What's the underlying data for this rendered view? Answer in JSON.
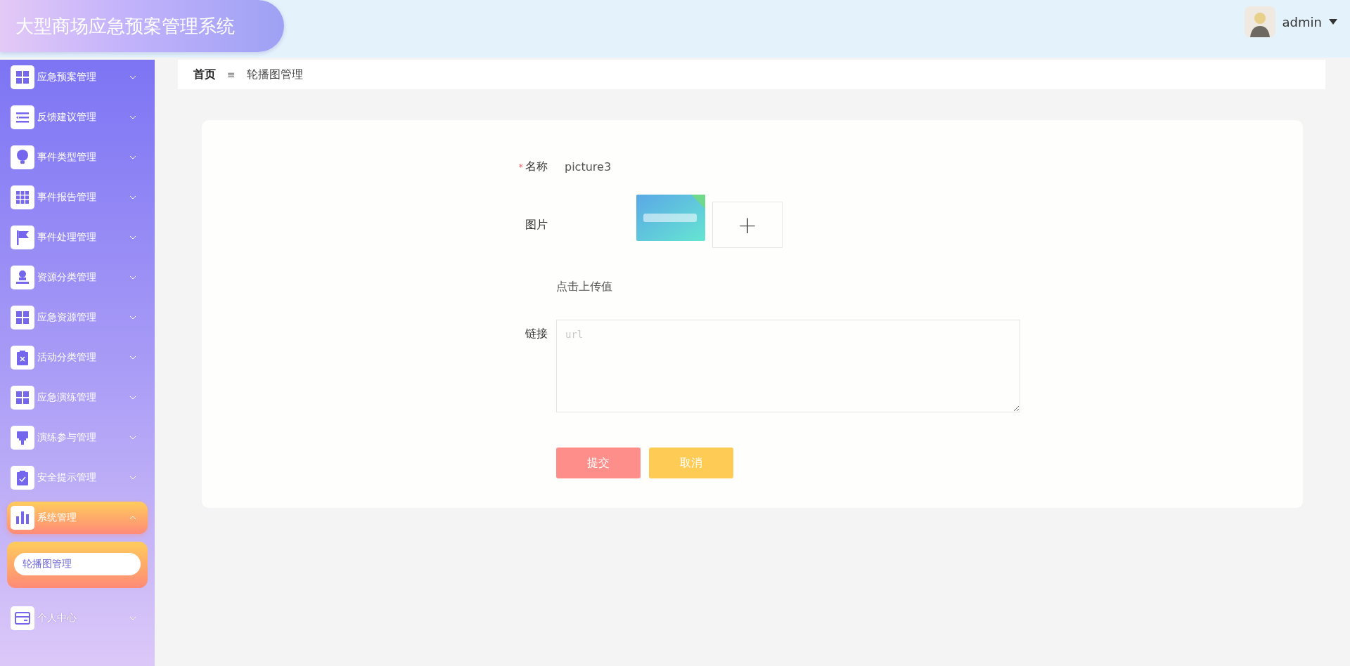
{
  "header": {
    "title": "大型商场应急预案管理系统",
    "user": {
      "name": "admin"
    }
  },
  "sidebar": {
    "items": [
      {
        "label": "应急预案管理",
        "expanded": false
      },
      {
        "label": "反馈建议管理",
        "expanded": false
      },
      {
        "label": "事件类型管理",
        "expanded": false
      },
      {
        "label": "事件报告管理",
        "expanded": false
      },
      {
        "label": "事件处理管理",
        "expanded": false
      },
      {
        "label": "资源分类管理",
        "expanded": false
      },
      {
        "label": "应急资源管理",
        "expanded": false
      },
      {
        "label": "活动分类管理",
        "expanded": false
      },
      {
        "label": "应急演练管理",
        "expanded": false
      },
      {
        "label": "演练参与管理",
        "expanded": false
      },
      {
        "label": "安全提示管理",
        "expanded": false
      },
      {
        "label": "系统管理",
        "expanded": true,
        "children": [
          {
            "label": "轮播图管理",
            "selected": true
          }
        ]
      },
      {
        "label": "个人中心",
        "expanded": false
      }
    ]
  },
  "breadcrumb": {
    "items": [
      "首页",
      "轮播图管理"
    ],
    "separator": "≡"
  },
  "form": {
    "name": {
      "label": "名称",
      "required": true,
      "required_mark": "*",
      "value": "picture3"
    },
    "picture": {
      "label": "图片",
      "hint": "点击上传值",
      "upload_symbol": "+"
    },
    "link": {
      "label": "链接",
      "placeholder": "url"
    },
    "buttons": [
      {
        "label": "提交",
        "kind": "submit"
      },
      {
        "label": "取消",
        "kind": "cancel"
      }
    ]
  }
}
